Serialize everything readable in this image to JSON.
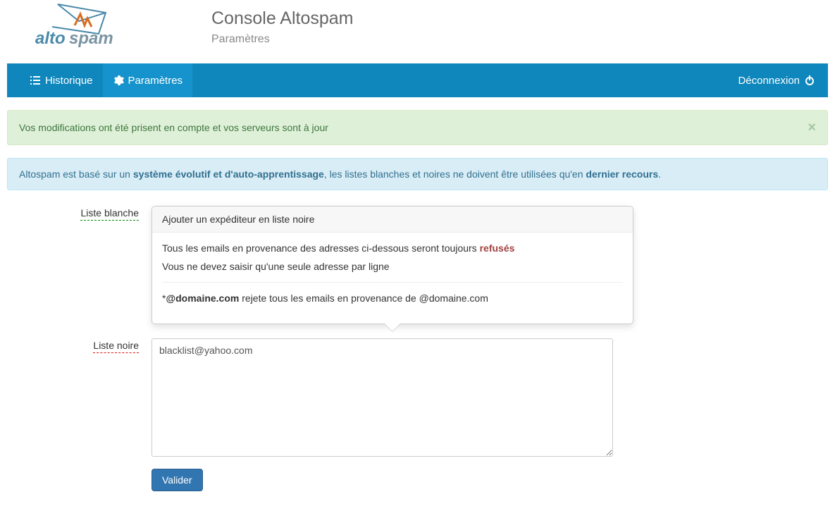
{
  "header": {
    "title": "Console Altospam",
    "subtitle": "Paramètres"
  },
  "nav": {
    "historique": "Historique",
    "parametres": "Paramètres",
    "logout": "Déconnexion"
  },
  "alerts": {
    "success": "Vos modifications ont été prisent en compte et vos serveurs sont à jour",
    "info_pre": "Altospam est basé sur un ",
    "info_strong1": "système évolutif et d'auto-apprentissage",
    "info_mid": ", les listes blanches et noires ne doivent être utilisées qu'en ",
    "info_strong2": "dernier recours",
    "info_end": "."
  },
  "form": {
    "whitelist_label": "Liste blanche",
    "blacklist_label": "Liste noire",
    "blacklist_value": "blacklist@yahoo.com",
    "submit": "Valider"
  },
  "popover": {
    "title": "Ajouter un expéditeur en liste noire",
    "line1_pre": "Tous les emails en provenance des adresses ci-dessous seront toujours ",
    "line1_strong": "refusés",
    "line2": "Vous ne devez saisir qu'une seule adresse par ligne",
    "line3_pre": "*",
    "line3_strong": "@domaine.com",
    "line3_rest": " rejete tous les emails en provenance de @domaine.com"
  }
}
